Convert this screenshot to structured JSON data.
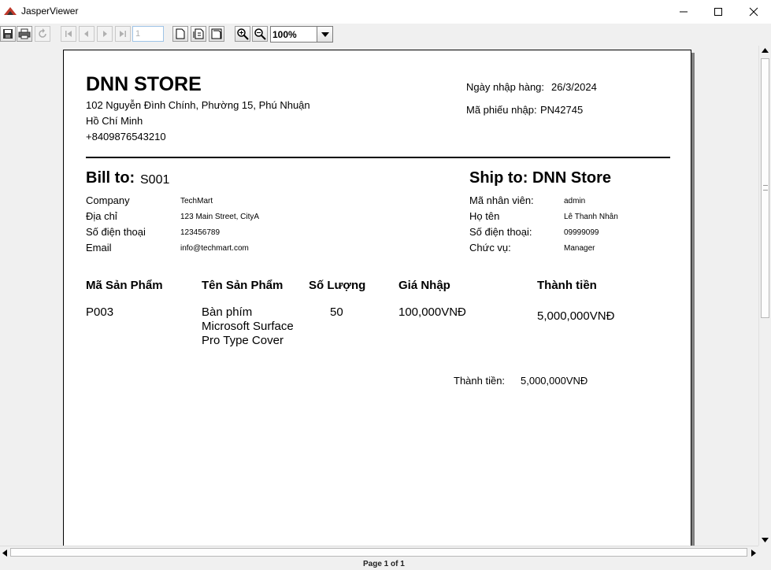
{
  "window": {
    "title": "JasperViewer"
  },
  "toolbar": {
    "page_number": "1",
    "zoom": "100%"
  },
  "report": {
    "store_name": "DNN STORE",
    "address_line1": "102 Nguyễn Đình Chính, Phường 15, Phú Nhuận",
    "address_line2": "Hồ Chí Minh",
    "phone": "+8409876543210",
    "import_date_label": "Ngày nhập hàng:",
    "import_date": "26/3/2024",
    "receipt_code_label": "Mã phiếu nhập:",
    "receipt_code": "PN42745",
    "bill_to_label": "Bill to:",
    "bill_to_id": "S001",
    "ship_to": "Ship to: DNN Store",
    "bill_fields": [
      {
        "label": "Company",
        "value": "TechMart"
      },
      {
        "label": "Địa chỉ",
        "value": "123 Main Street, CityA"
      },
      {
        "label": "Số điện thoại",
        "value": "123456789"
      },
      {
        "label": "Email",
        "value": "info@techmart.com"
      }
    ],
    "ship_fields": [
      {
        "label": "Mã nhân viên:",
        "value": "admin"
      },
      {
        "label": "Họ tên",
        "value": "Lê Thanh Nhân"
      },
      {
        "label": "Số điện thoại:",
        "value": "09999099"
      },
      {
        "label": "Chức vụ:",
        "value": "Manager"
      }
    ],
    "columns": [
      "Mã Sản Phẩm",
      "Tên Sản Phẩm",
      "Số Lượng",
      "Giá Nhập",
      "Thành tiền"
    ],
    "rows": [
      {
        "code": "P003",
        "name_lines": [
          "Bàn phím",
          "Microsoft Surface",
          "Pro Type Cover"
        ],
        "quantity": "50",
        "price": "100,000VNĐ",
        "amount": "5,000,000VNĐ"
      }
    ],
    "total_label": "Thành tiền:",
    "total_value": "5,000,000VNĐ"
  },
  "status": {
    "page_info": "Page 1 of 1"
  }
}
